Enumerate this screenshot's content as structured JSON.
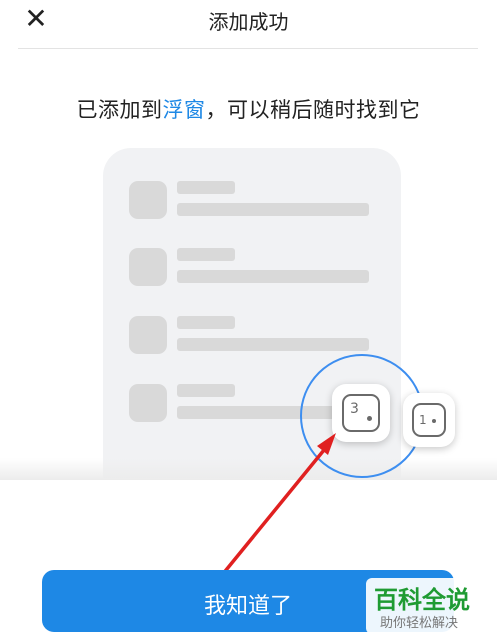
{
  "header": {
    "title": "添加成功",
    "close_icon": "close-icon"
  },
  "message": {
    "prefix": "已添加到",
    "link": "浮窗",
    "suffix": "，可以稍后随时找到它"
  },
  "float_window": {
    "primary_number": "3",
    "secondary_number": "1",
    "ring_color": "#3d8ef0"
  },
  "confirm_button": {
    "label": "我知道了",
    "color": "#1e88e5"
  },
  "watermark": {
    "title": "百科全说",
    "subtitle": "助你轻松解决"
  }
}
